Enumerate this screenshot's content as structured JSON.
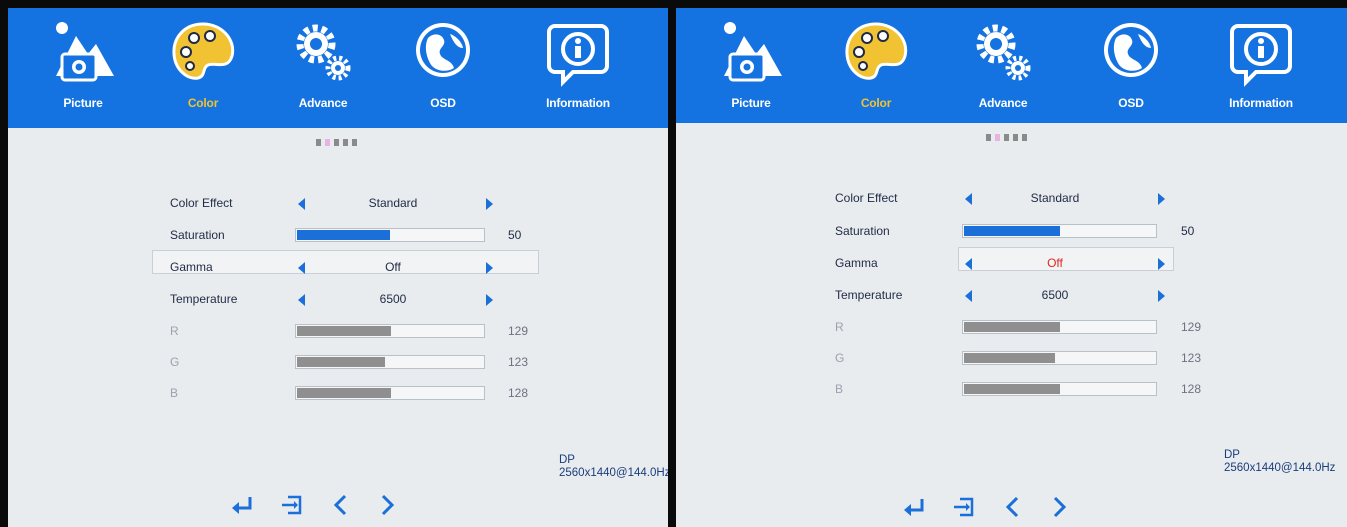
{
  "menu": {
    "tabs": [
      {
        "label": "Picture",
        "icon": "picture-icon"
      },
      {
        "label": "Color",
        "icon": "palette-icon",
        "active": true
      },
      {
        "label": "Advance",
        "icon": "gears-icon"
      },
      {
        "label": "OSD",
        "icon": "globe-icon"
      },
      {
        "label": "Information",
        "icon": "info-icon"
      }
    ]
  },
  "page_indicator": {
    "pages": 5,
    "current": 2
  },
  "settings": {
    "color_effect": {
      "label": "Color Effect",
      "value": "Standard"
    },
    "saturation": {
      "label": "Saturation",
      "value": "50",
      "fill": 0.5
    },
    "gamma": {
      "label": "Gamma",
      "value": "Off"
    },
    "temperature": {
      "label": "Temperature",
      "value": "6500"
    },
    "r": {
      "label": "R",
      "value": "129",
      "fill": 0.5
    },
    "g": {
      "label": "G",
      "value": "123",
      "fill": 0.47
    },
    "b": {
      "label": "B",
      "value": "128",
      "fill": 0.5
    }
  },
  "footer": {
    "icons": [
      "enter-icon",
      "exit-icon",
      "prev-icon",
      "next-icon"
    ],
    "input_source": "DP",
    "resolution": "2560x1440@144.0Hz"
  },
  "colors": {
    "header_blue": "#1473e0",
    "active_tab_yellow": "#f1c232",
    "slider_blue": "#1a6fd8",
    "slider_gray": "#8f8f8f",
    "selected_value_red": "#e0271e"
  }
}
